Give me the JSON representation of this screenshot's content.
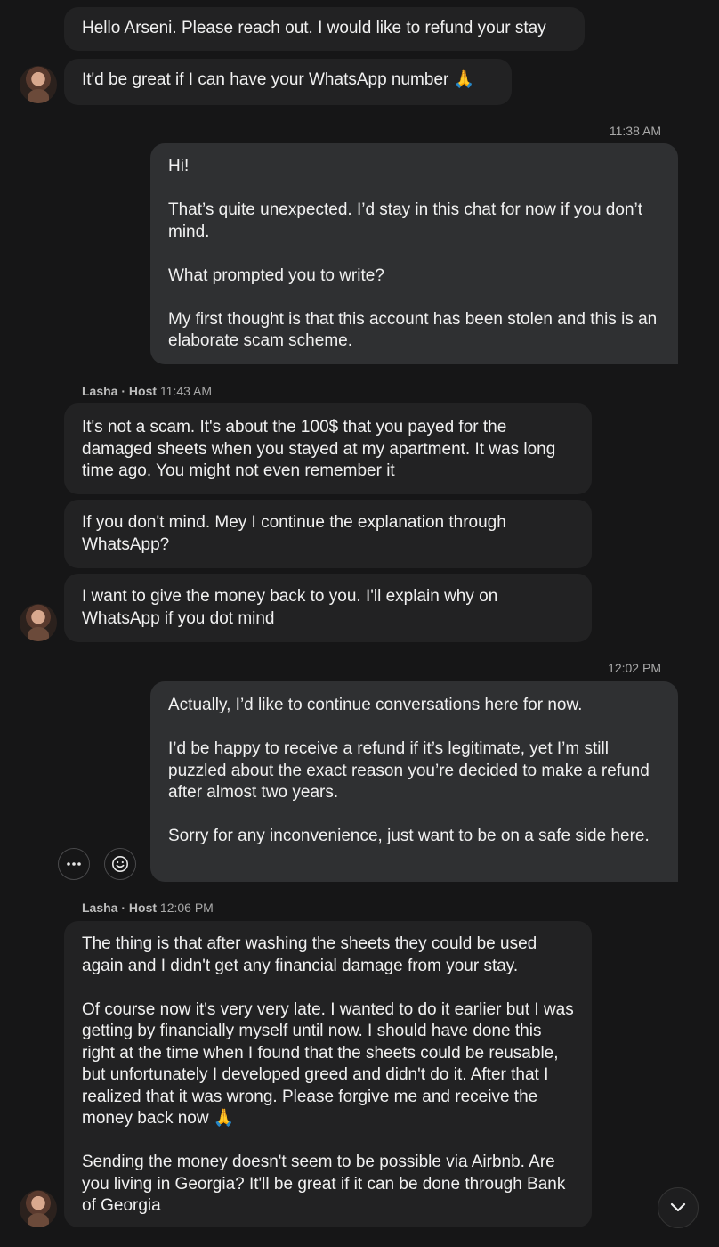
{
  "messages": {
    "m1": "Hello Arseni. Please reach out. I would like to refund your stay",
    "m2": "It'd be great if I can have your WhatsApp number 🙏",
    "t1": "11:38 AM",
    "m3": "Hi!\n\nThat’s quite unexpected. I’d stay in this chat for now if you don’t mind.\n\nWhat prompted you to write?\n\nMy first thought is that this account has been stolen and this is an elaborate scam scheme.",
    "s1_name": "Lasha · Host",
    "s1_time": "11:43 AM",
    "m4": "It's not a scam. It's about the 100$ that you payed for the damaged sheets when you stayed at my apartment. It was long time ago. You might not even remember it",
    "m5": "If you don't mind. Mey I continue the explanation through WhatsApp?",
    "m6": "I want to give the money back to you. I'll explain why on WhatsApp if you dot mind",
    "t2": "12:02 PM",
    "m7": "Actually, I’d like to continue conversations here for now.\n\nI’d be happy to receive a refund if it’s legitimate, yet I’m still puzzled about the exact reason you’re decided to make a refund after almost two years.\n\nSorry for any inconvenience, just want to be on a safe side here.",
    "s2_name": "Lasha · Host",
    "s2_time": "12:06 PM",
    "m8": "The thing is that after washing the sheets they could be used again and I didn't get any financial damage from your stay.\n\nOf course now it's very very late. I wanted to do it earlier but I was getting by financially myself until now. I should have done this right at the time when I found that the sheets could be reusable, but unfortunately I developed greed and didn't do it. After that I realized that it was wrong. Please forgive me and receive the money back now 🙏\n\nSending the money doesn't seem to be possible via Airbnb. Are you living in Georgia? It'll be great if it can be done through Bank of Georgia"
  },
  "icons": {
    "more": "more-options-icon",
    "react": "emoji-react-icon",
    "scroll": "chevron-down-icon"
  },
  "colors": {
    "background": "#161617",
    "host_bubble": "#222223",
    "own_bubble": "#2f3032",
    "meta_text": "#a9a9a9"
  }
}
